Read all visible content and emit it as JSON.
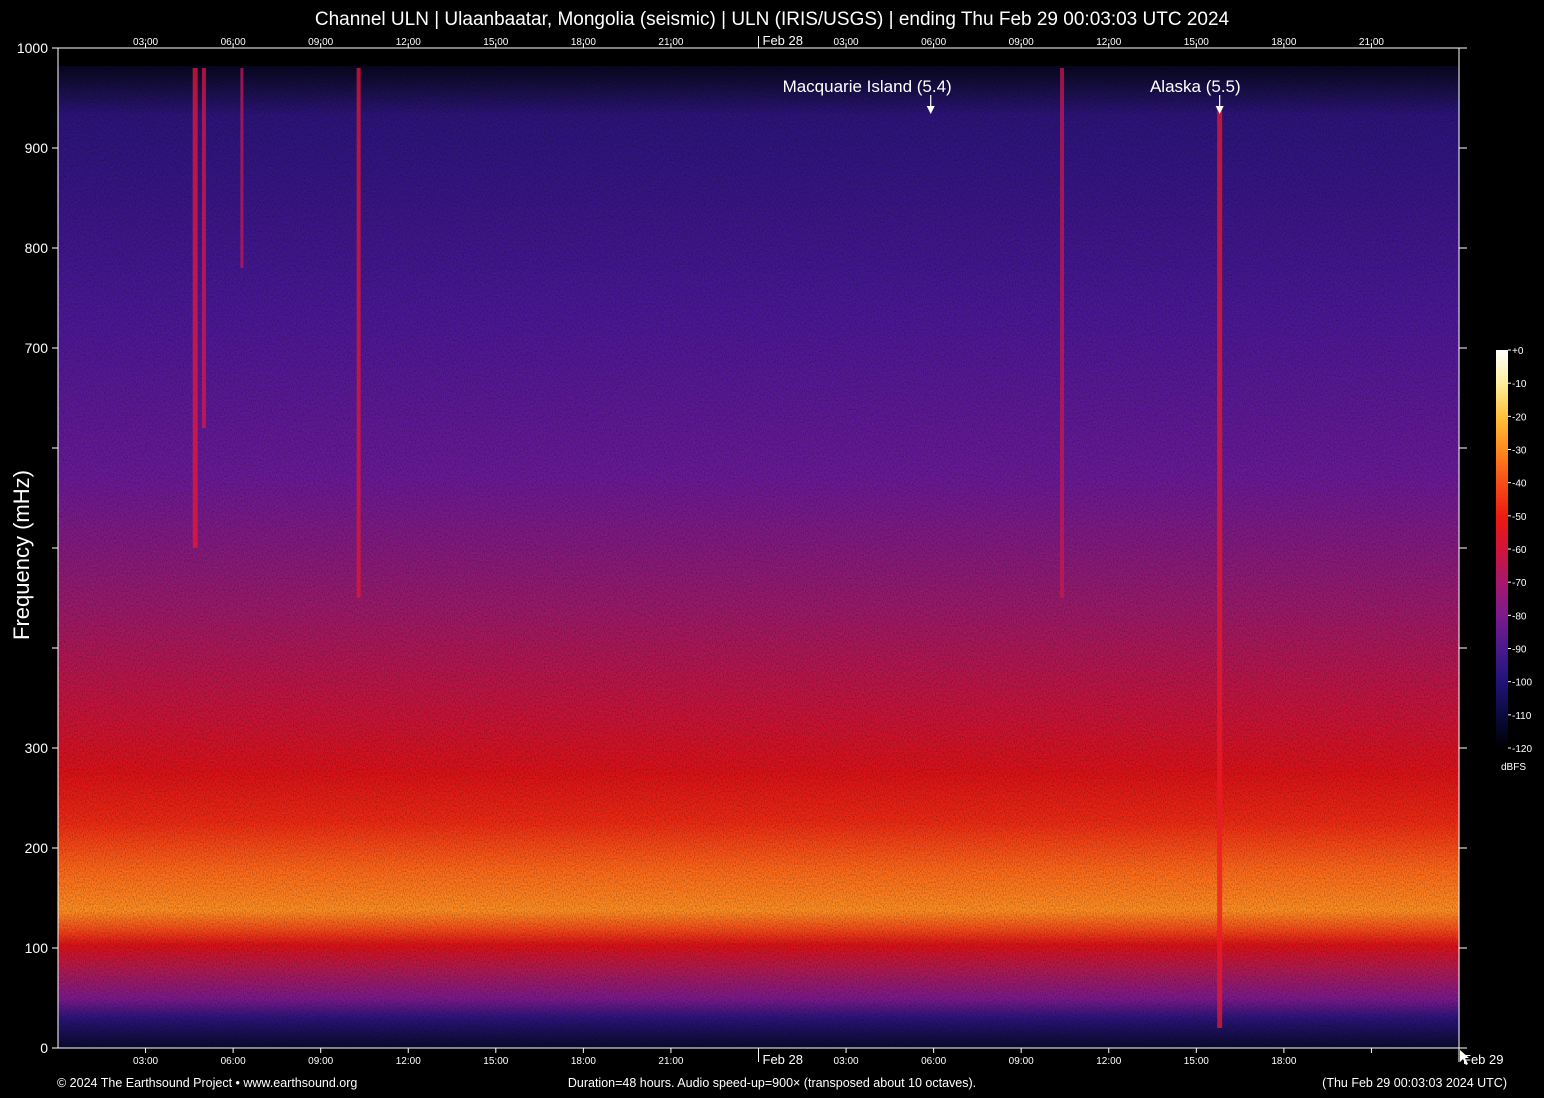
{
  "title": "Channel ULN | Ulaanbaatar, Mongolia (seismic) | ULN (IRIS/USGS) | ending Thu Feb 29 00:03:03 UTC 2024",
  "footer": {
    "copyright": "© 2024 The Earthsound Project • www.earthsound.org",
    "duration": "Duration=48 hours. Audio speed-up=900× (transposed about 10 octaves).",
    "timestamp": "(Thu Feb 29 00:03:03 2024 UTC)"
  },
  "colorbar": {
    "unit": "dBFS",
    "ticks": [
      "+0",
      "-10",
      "-20",
      "-30",
      "-40",
      "-50",
      "-60",
      "-70",
      "-80",
      "-90",
      "-100",
      "-110",
      "-120"
    ],
    "colors": [
      "#000000",
      "#0a0a3c",
      "#22137a",
      "#4a1a8e",
      "#7a1a8c",
      "#a8186c",
      "#d0143a",
      "#ec1a12",
      "#f8501a",
      "#ff8a1e",
      "#ffc038",
      "#fff0a0",
      "#ffffff"
    ]
  },
  "chart_data": {
    "type": "heatmap",
    "title": "Channel ULN | Ulaanbaatar, Mongolia (seismic) | ULN (IRIS/USGS) | ending Thu Feb 29 00:03:03 UTC 2024",
    "ylabel": "Frequency (mHz)",
    "xlabel": "",
    "ylim": [
      0,
      1000
    ],
    "xlim_hours": [
      0,
      48
    ],
    "y_ticks": [
      "0",
      "100",
      "200",
      "300",
      "",
      "",
      "",
      "700",
      "800",
      "900",
      "1000"
    ],
    "x_tick_labels": [
      "03:00",
      "06:00",
      "09:00",
      "12:00",
      "15:00",
      "18:00",
      "21:00",
      "Feb 28",
      "03:00",
      "06:00",
      "09:00",
      "12:00",
      "15:00",
      "18:00",
      "",
      "Feb 29"
    ],
    "x_tick_top_labels": [
      "03:00",
      "06:00",
      "09:00",
      "12:00",
      "15:00",
      "18:00",
      "21:00",
      "Feb 28",
      "03:00",
      "06:00",
      "09:00",
      "12:00",
      "15:00",
      "18:00",
      "21:00"
    ],
    "annotations": [
      {
        "label": "Macquarie Island (5.4)",
        "hour": 29.9
      },
      {
        "label": "Alaska (5.5)",
        "hour": 39.8
      }
    ],
    "color_scale": "dBFS",
    "value_range": [
      -120,
      0
    ]
  }
}
